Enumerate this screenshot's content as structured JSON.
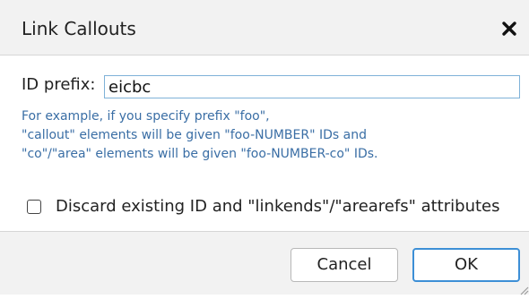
{
  "dialog": {
    "title": "Link Callouts",
    "close_icon": "close-icon"
  },
  "form": {
    "id_prefix_label": "ID prefix:",
    "id_prefix_value": "eicbc",
    "hint_lines": [
      "For example, if you specify prefix \"foo\",",
      "\"callout\" elements will be given \"foo-NUMBER\" IDs and",
      "\"co\"/\"area\" elements will be given \"foo-NUMBER-co\" IDs."
    ],
    "discard_checkbox": {
      "label": "Discard existing ID and \"linkends\"/\"arearefs\" attributes",
      "checked": false
    }
  },
  "buttons": {
    "cancel": "Cancel",
    "ok": "OK"
  },
  "colors": {
    "hint_text": "#3a6ea5",
    "accent": "#3d8fd6",
    "input_border": "#7fb2d8"
  }
}
